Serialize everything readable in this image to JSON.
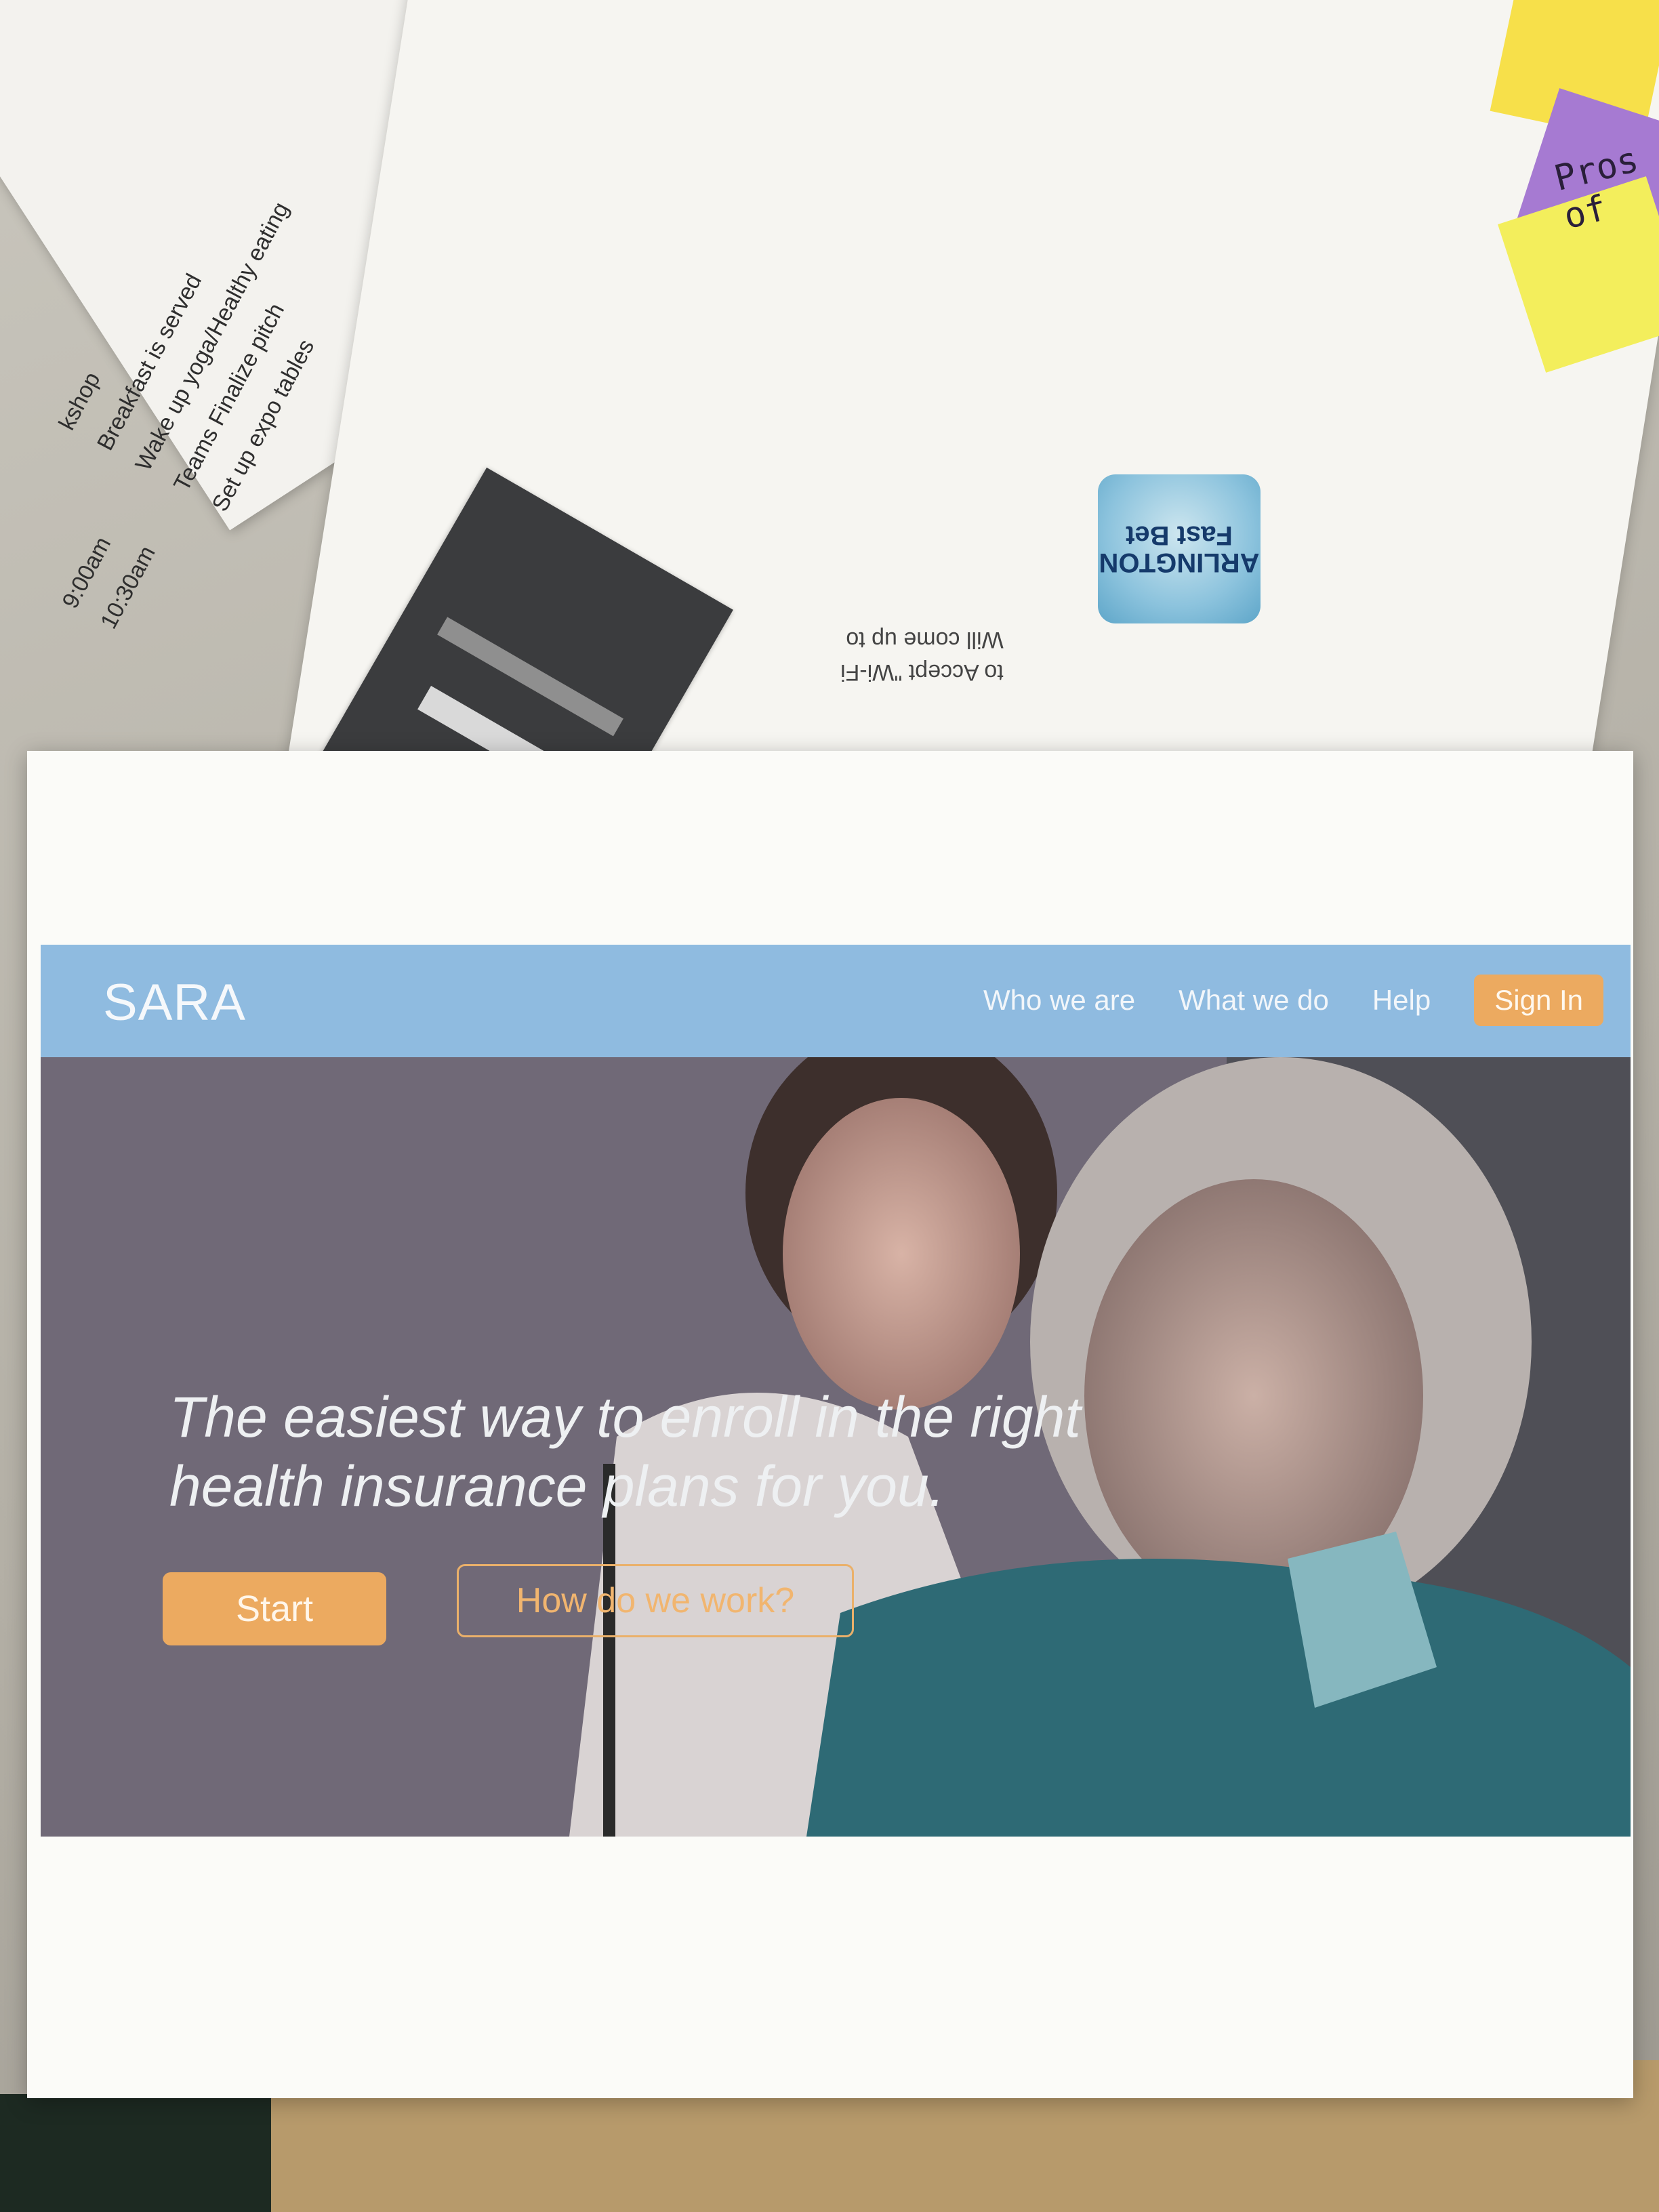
{
  "background": {
    "schedule": [
      {
        "time": "",
        "item": "kshop"
      },
      {
        "time": "",
        "item": "Breakfast is served"
      },
      {
        "time": "9:00am",
        "item": "Wake up yoga/Healthy eating"
      },
      {
        "time": "10:30am",
        "item": "Teams Finalize pitch"
      },
      {
        "time": "",
        "item": "Set up expo tables"
      }
    ],
    "wifi_ad_logo": "ARLINGTON Fast Bet",
    "wifi_lines": [
      "to Accept \"Wi-Fi",
      "Will come up to"
    ],
    "sticky_note_text": [
      "Pros",
      "of"
    ]
  },
  "site": {
    "logo": "SARA",
    "nav": {
      "who": "Who we are",
      "what": "What we do",
      "help": "Help",
      "signin": "Sign In"
    },
    "hero": {
      "headline_line1": "The easiest way to enroll in the right",
      "headline_line2": "health insurance plans for you.",
      "start": "Start",
      "how": "How do we work?"
    },
    "colors": {
      "nav_bg": "#8fbbe0",
      "accent": "#ecaa60"
    }
  }
}
